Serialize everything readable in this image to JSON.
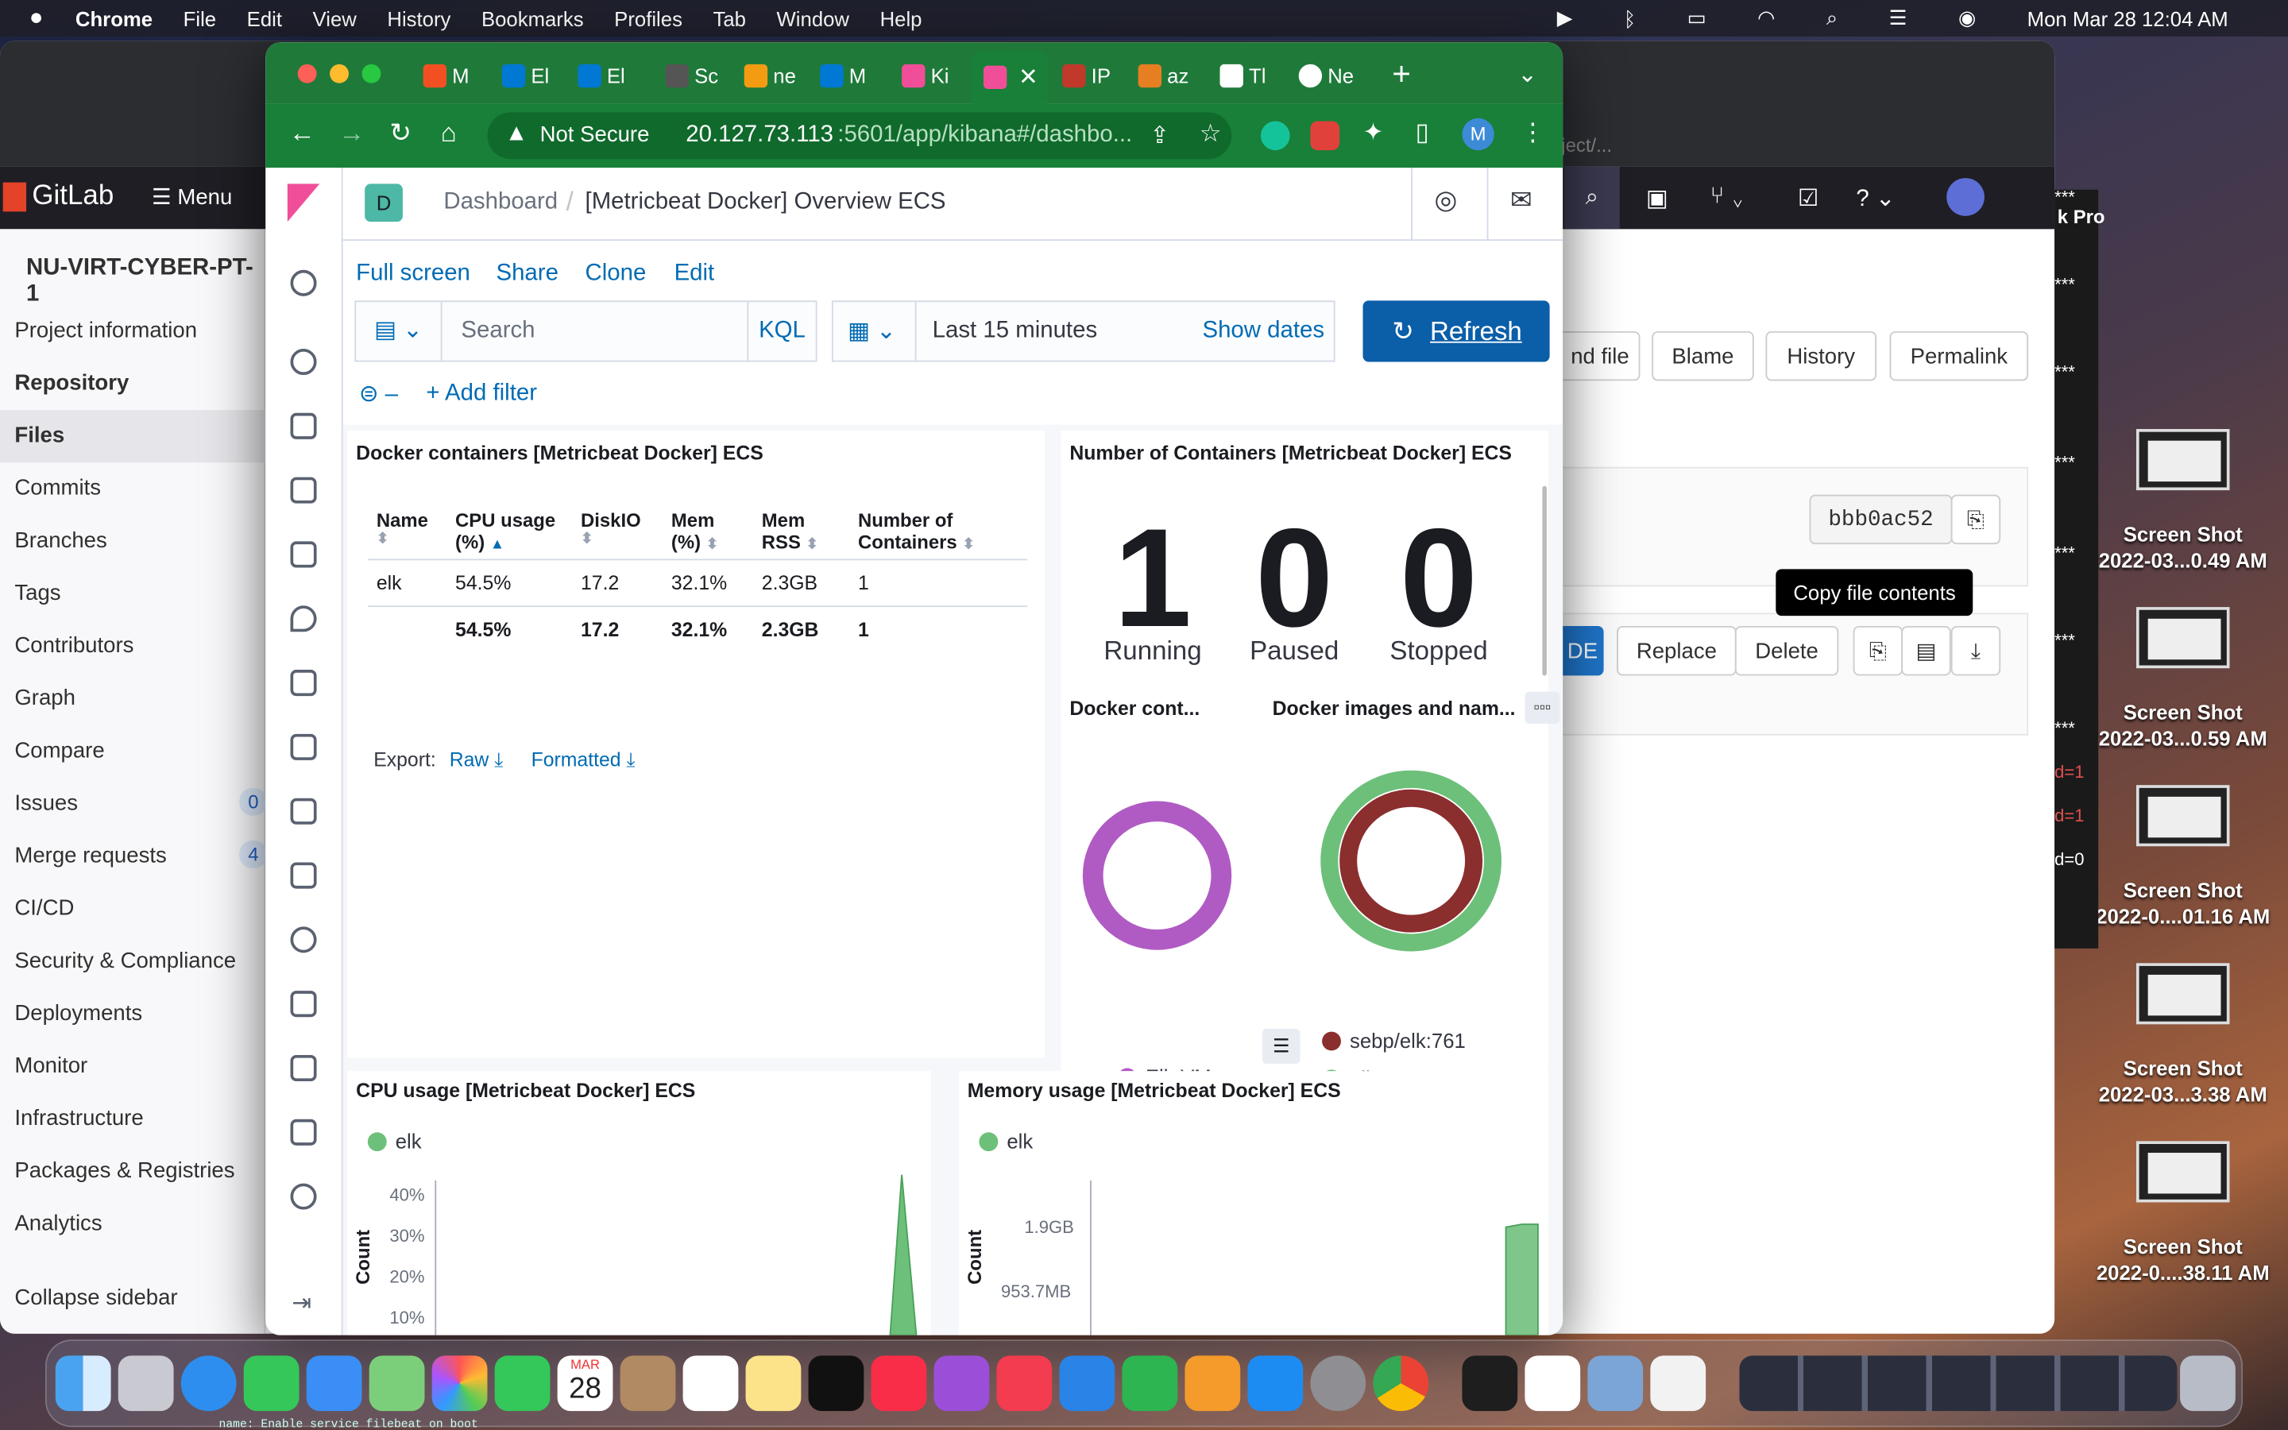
{
  "menubar": {
    "apple": "",
    "app": "Chrome",
    "items": [
      "File",
      "Edit",
      "View",
      "History",
      "Bookmarks",
      "Profiles",
      "Tab",
      "Window",
      "Help"
    ],
    "datetime": "Mon Mar 28  12:04 AM"
  },
  "gitlab": {
    "brand": "GitLab",
    "menu": "Menu",
    "project": "NU-VIRT-CYBER-PT-1",
    "sidebar": [
      "Project information",
      "Repository",
      "Files",
      "Commits",
      "Branches",
      "Tags",
      "Contributors",
      "Graph",
      "Compare",
      "Issues",
      "Merge requests",
      "CI/CD",
      "Security & Compliance",
      "Deployments",
      "Monitor",
      "Infrastructure",
      "Packages & Registries",
      "Analytics"
    ],
    "issues_count": "0",
    "mr_count": "4",
    "collapse": "Collapse sidebar",
    "buttons": {
      "find_file": "nd file",
      "blame": "Blame",
      "history": "History",
      "permalink": "Permalink",
      "replace": "Replace",
      "delete": "Delete",
      "ide": "DE"
    },
    "commit": "bbb0ac52",
    "tooltip": "Copy file contents",
    "breadcrumb_tail": "ject/...",
    "right_label": "k Pro",
    "side_text": [
      "***",
      "***",
      "***",
      "***",
      "***",
      "***",
      "***",
      "d=1",
      "d=1",
      "d=0"
    ]
  },
  "screenshots": [
    {
      "l1": "Screen Shot",
      "l2": "2022-03...0.49 AM"
    },
    {
      "l1": "Screen Shot",
      "l2": "2022-03...0.59 AM"
    },
    {
      "l1": "Screen Shot",
      "l2": "2022-0....01.16 AM"
    },
    {
      "l1": "Screen Shot",
      "l2": "2022-03...3.38 AM"
    },
    {
      "l1": "Screen Shot",
      "l2": "2022-0....38.11 AM"
    }
  ],
  "browser": {
    "tabs": [
      "M",
      "El",
      "El",
      "Sc",
      "ne",
      "M",
      "Ki",
      "",
      "IP",
      "az",
      "Tl",
      "Ne"
    ],
    "security": "Not Secure",
    "url_host": "20.127.73.113",
    "url_rest": ":5601/app/kibana#/dashbo...",
    "profile": "M"
  },
  "kibana": {
    "space": "D",
    "breadcrumb_root": "Dashboard",
    "breadcrumb_current": "[Metricbeat Docker] Overview ECS",
    "actions": [
      "Full screen",
      "Share",
      "Clone",
      "Edit"
    ],
    "search_placeholder": "Search",
    "kql": "KQL",
    "time": "Last 15 minutes",
    "show_dates": "Show dates",
    "refresh": "Refresh",
    "add_filter": "+ Add filter",
    "table_panel": {
      "title": "Docker containers [Metricbeat Docker] ECS",
      "headers": [
        "Name",
        "CPU usage (%)",
        "DiskIO",
        "Mem (%)",
        "Mem RSS",
        "Number of Containers"
      ],
      "rows": [
        [
          "elk",
          "54.5%",
          "17.2",
          "32.1%",
          "2.3GB",
          "1"
        ]
      ],
      "totals": [
        "",
        "54.5%",
        "17.2",
        "32.1%",
        "2.3GB",
        "1"
      ],
      "export": "Export:",
      "raw": "Raw",
      "formatted": "Formatted"
    },
    "count_panel": {
      "title": "Number of Containers [Metricbeat Docker] ECS",
      "values": [
        "1",
        "0",
        "0"
      ],
      "labels": [
        "Running",
        "Paused",
        "Stopped"
      ]
    },
    "donut1": {
      "title": "Docker cont...",
      "legend": "Elk-VM",
      "color": "#b05bc4"
    },
    "donut2": {
      "title": "Docker images and nam...",
      "legend": [
        "sebp/elk:761",
        "elk"
      ],
      "colors": [
        "#8b2e2e",
        "#6dc07a"
      ]
    },
    "cpu_panel": {
      "title": "CPU usage [Metricbeat Docker] ECS",
      "legend": "elk",
      "ylabel": "Count",
      "ticks": [
        "40%",
        "30%",
        "20%",
        "10%"
      ]
    },
    "mem_panel": {
      "title": "Memory usage [Metricbeat Docker] ECS",
      "legend": "elk",
      "ylabel": "Count",
      "ticks": [
        "1.9GB",
        "953.7MB"
      ]
    }
  },
  "dock": {
    "date_month": "MAR",
    "date_day": "28"
  },
  "terminal_peek": "name: Enable service filebeat on boot",
  "colors": {
    "kibana_blue": "#006bb4",
    "refresh_bg": "#0b5ea8",
    "chrome_green": "#188038",
    "gitlab_dark": "#1f1e24",
    "elk_green": "#6dc07a"
  }
}
